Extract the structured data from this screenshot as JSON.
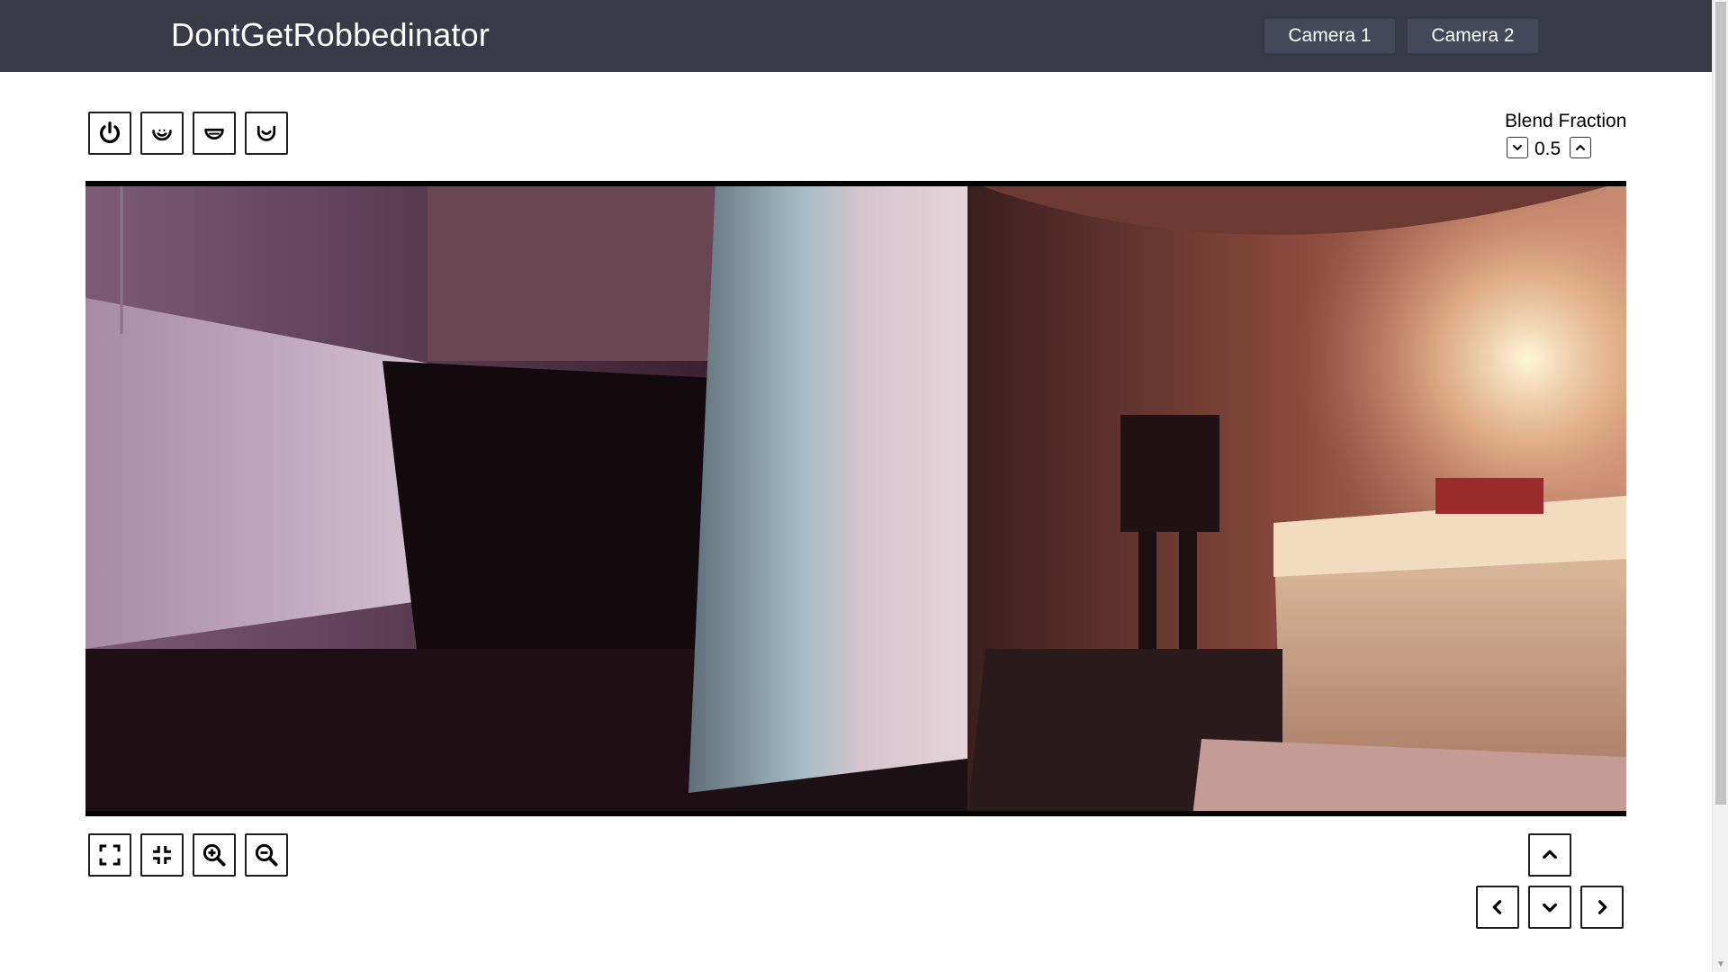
{
  "header": {
    "title": "DontGetRobbedinator",
    "cameras": [
      "Camera 1",
      "Camera 2"
    ]
  },
  "toolbar_top": {
    "buttons": [
      "power-icon",
      "face-smile-icon",
      "face-neutral-icon",
      "face-open-icon"
    ]
  },
  "blend": {
    "label": "Blend Fraction",
    "value": "0.5"
  },
  "toolbar_bottom": {
    "buttons": [
      "fullscreen-icon",
      "exit-fullscreen-icon",
      "zoom-in-icon",
      "zoom-out-icon"
    ]
  },
  "pan_controls": [
    "chevron-up-icon",
    "chevron-left-icon",
    "chevron-down-icon",
    "chevron-right-icon"
  ],
  "colors": {
    "header_bg": "#383a48",
    "header_button_bg": "#45485a",
    "text": "#000000"
  }
}
